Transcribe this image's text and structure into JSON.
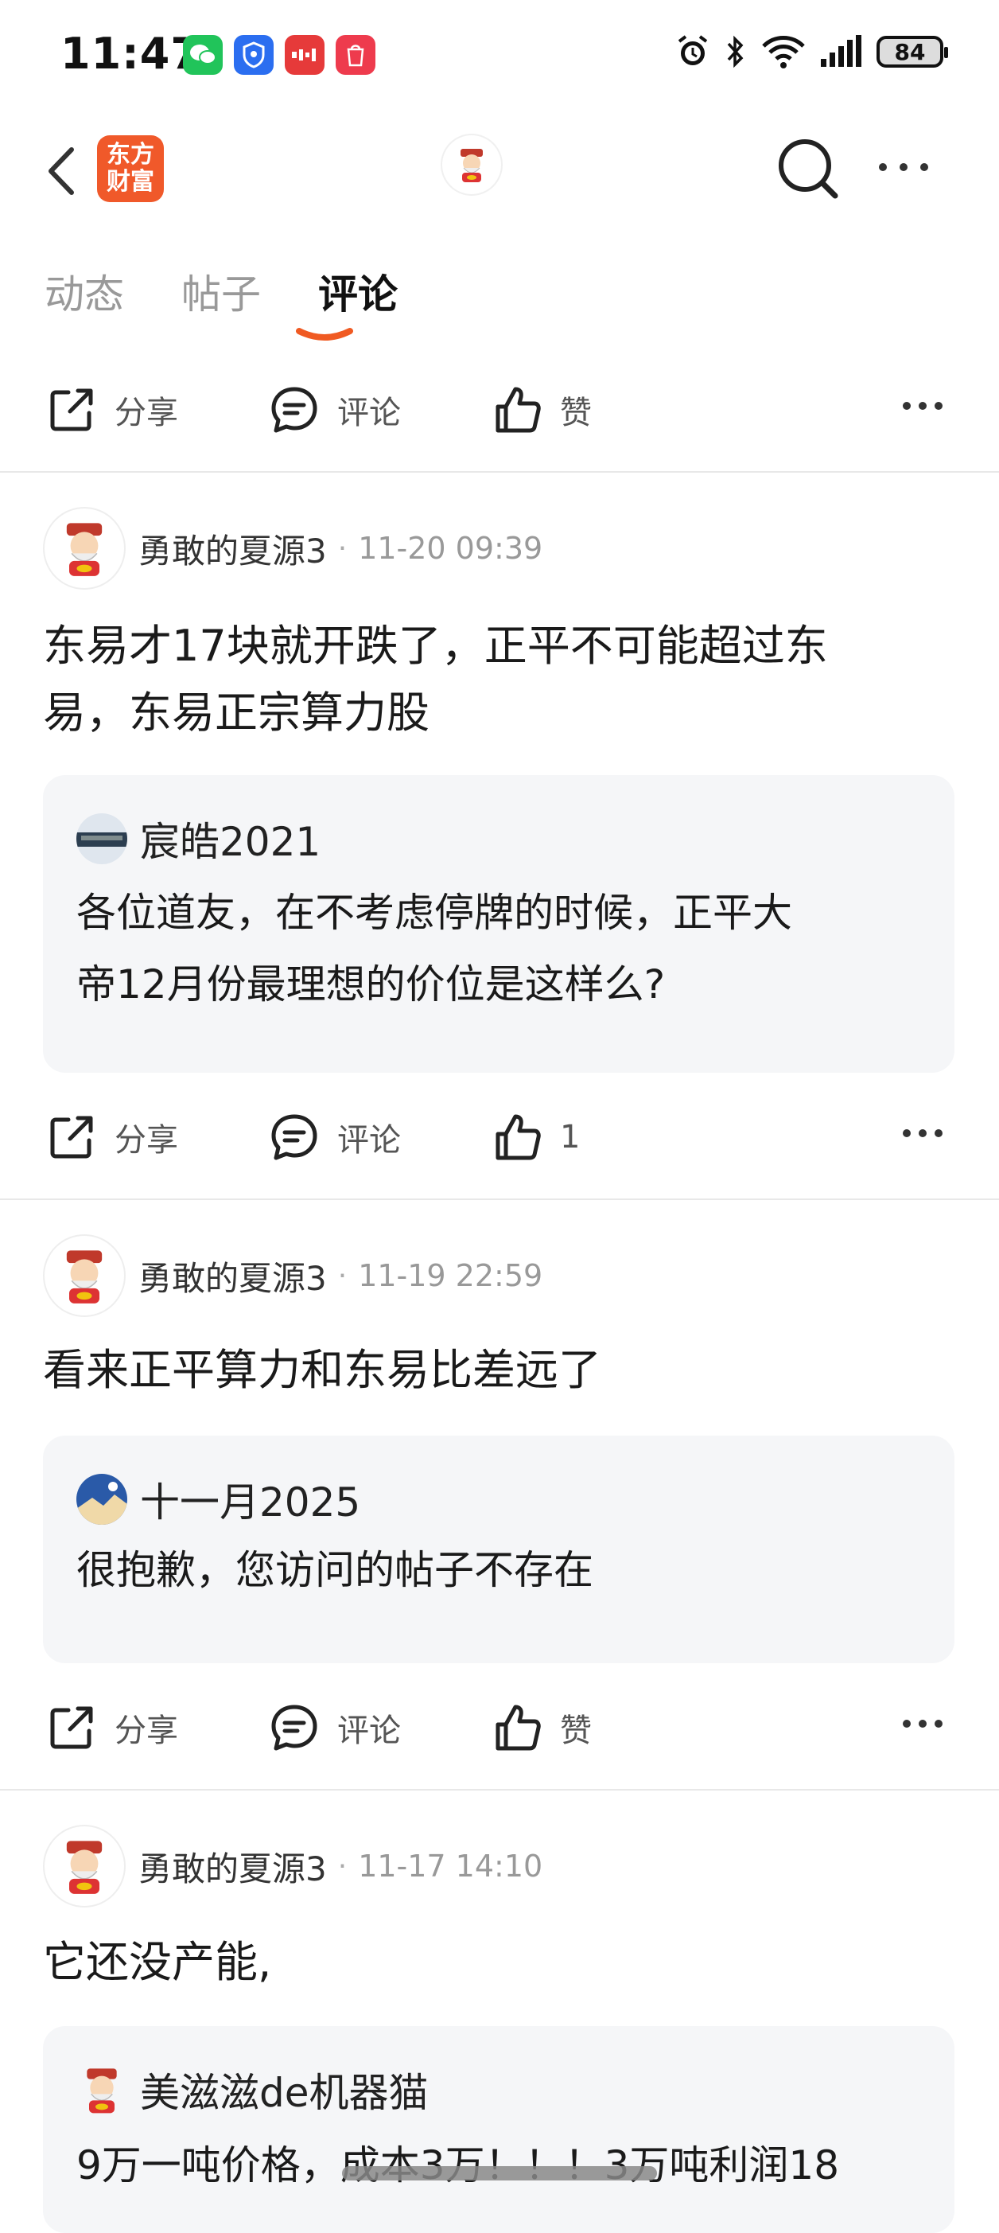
{
  "status_bar": {
    "time": "11:47",
    "battery": "84"
  },
  "header": {
    "logo_line1": "东方",
    "logo_line2": "财富"
  },
  "tabs": [
    {
      "label": "动态"
    },
    {
      "label": "帖子"
    },
    {
      "label": "评论"
    }
  ],
  "actions": {
    "share": "分享",
    "comment": "评论",
    "like": "赞"
  },
  "posts": [
    {
      "author": "勇敢的夏源3",
      "time": "11-20 09:39",
      "text_line1": "东易才17块就开跌了，正平不可能超过东",
      "text_line2": "易，东易正宗算力股",
      "quote": {
        "author": "宸皓2021",
        "line1": "各位道友，在不考虑停牌的时候，正平大",
        "line2": "帝12月份最理想的价位是这样么?"
      },
      "likes": "1"
    },
    {
      "author": "勇敢的夏源3",
      "time": "11-19 22:59",
      "text_line1": "看来正平算力和东易比差远了",
      "quote": {
        "author": "十一月2025",
        "line1": "很抱歉，您访问的帖子不存在"
      }
    },
    {
      "author": "勇敢的夏源3",
      "time": "11-17 14:10",
      "text_line1": "它还没产能,",
      "quote": {
        "author": "美滋滋de机器猫",
        "line1": "9万一吨价格，成本3万！！！3万吨利润18"
      }
    }
  ]
}
